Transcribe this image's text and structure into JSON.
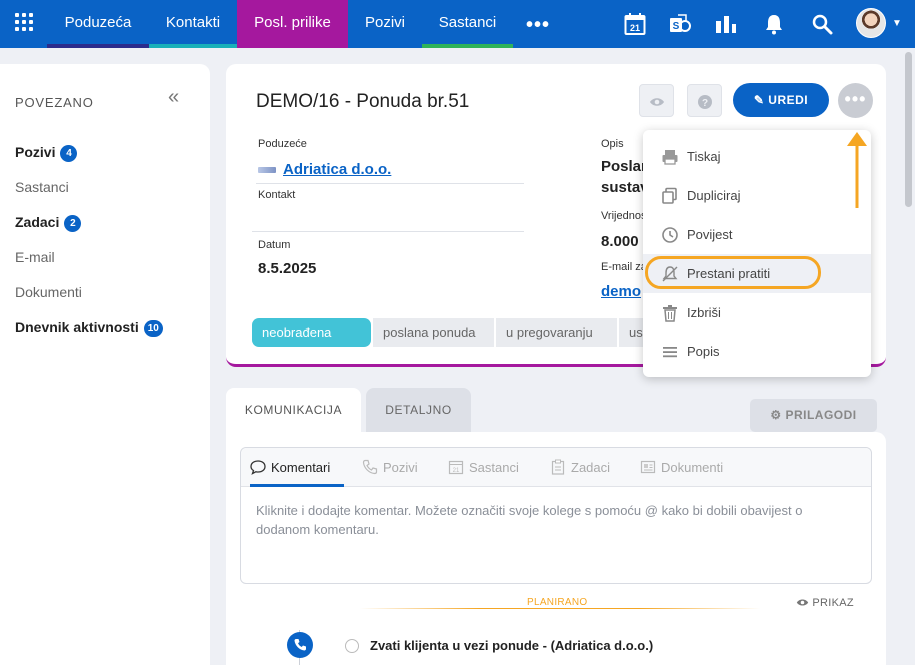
{
  "nav": {
    "items": [
      {
        "label": "Poduzeća",
        "underline": "#2c2c8c"
      },
      {
        "label": "Kontakti",
        "underline": "#19b0b9"
      },
      {
        "label": "Posl. prilike",
        "underline": "#a5189e"
      },
      {
        "label": "Pozivi",
        "underline": ""
      },
      {
        "label": "Sastanci",
        "underline": "#2fb35a"
      }
    ],
    "more": "•••",
    "calendar_day": "21"
  },
  "left": {
    "title": "POVEZANO",
    "items": [
      {
        "label": "Pozivi",
        "badge": "4",
        "bold": true
      },
      {
        "label": "Sastanci",
        "badge": "",
        "bold": false
      },
      {
        "label": "Zadaci",
        "badge": "2",
        "bold": true
      },
      {
        "label": "E-mail",
        "badge": "",
        "bold": false
      },
      {
        "label": "Dokumenti",
        "badge": "",
        "bold": false
      },
      {
        "label": "Dnevnik aktivnosti",
        "badge": "10",
        "bold": true
      }
    ]
  },
  "record": {
    "title": "DEMO/16 - Ponuda br.51",
    "edit_label": "UREDI",
    "more_label": "•••",
    "fields": {
      "company_label": "Poduzeće",
      "company_value": "Adriatica d.o.o.",
      "contact_label": "Kontakt",
      "date_label": "Datum",
      "date_value": "8.5.2025",
      "desc_label": "Opis",
      "desc_value_1": "Poslan",
      "desc_value_2": "sustav",
      "value_label": "Vrijednost",
      "value_value": "8.000",
      "email_label": "E-mail za",
      "email_value": "demo"
    },
    "stages": [
      "neobrađena",
      "poslana ponuda",
      "u pregovaranju",
      "us"
    ]
  },
  "dropdown": {
    "items": [
      {
        "label": "Tiskaj",
        "icon": "printer-icon"
      },
      {
        "label": "Dupliciraj",
        "icon": "duplicate-icon"
      },
      {
        "label": "Povijest",
        "icon": "clock-icon"
      },
      {
        "label": "Prestani pratiti",
        "icon": "bell-off-icon"
      },
      {
        "label": "Izbriši",
        "icon": "trash-icon"
      },
      {
        "label": "Popis",
        "icon": "list-icon"
      }
    ]
  },
  "tabs": {
    "komunikacija": "KOMUNIKACIJA",
    "detaljno": "DETALJNO",
    "prilagodi": "PRILAGODI"
  },
  "comm": {
    "tabs": [
      "Komentari",
      "Pozivi",
      "Sastanci",
      "Zadaci",
      "Dokumenti"
    ],
    "placeholder": "Kliknite i dodajte komentar. Možete označiti svoje kolege s pomoću @ kako bi dobili obavijest o dodanom komentaru."
  },
  "timeline": {
    "section": "PLANIRANO",
    "view": "PRIKAZ",
    "task": "Zvati klijenta u vezi ponude - (Adriatica d.o.o.)"
  },
  "colors": {
    "brand": "#0a63c6",
    "accent": "#a5189e",
    "highlight": "#f5a623",
    "stage_active": "#42c3d7"
  }
}
